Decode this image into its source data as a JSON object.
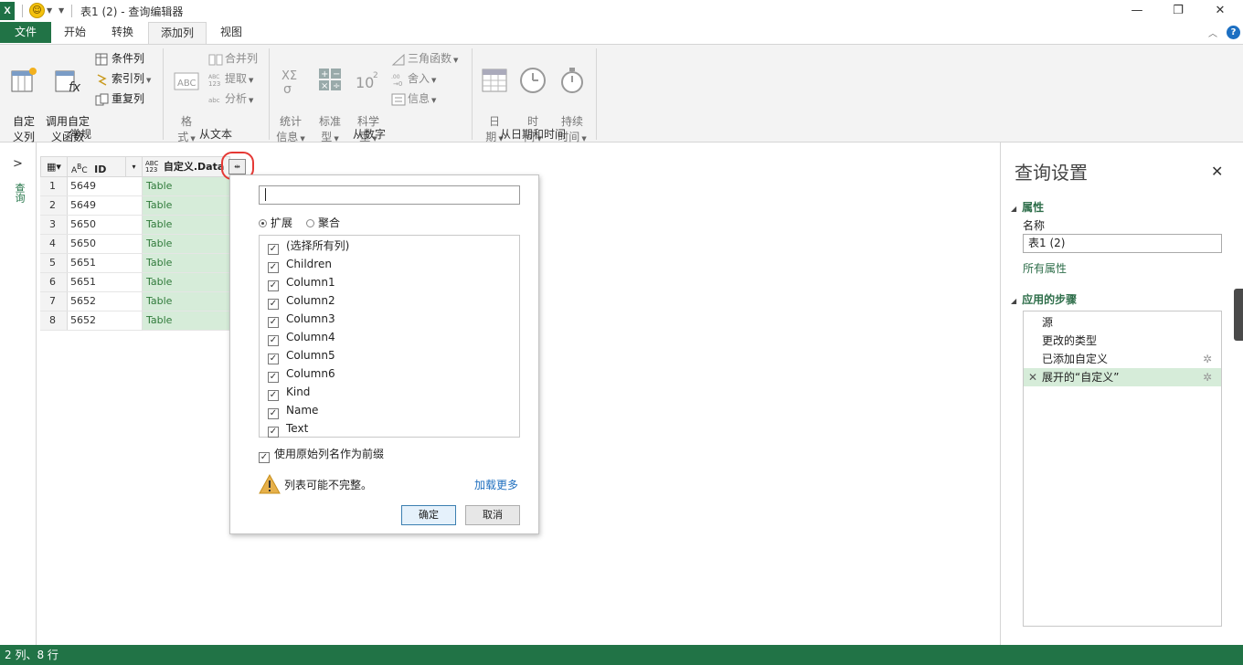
{
  "window": {
    "title": "表1 (2) - 查询编辑器",
    "app_logo": "X"
  },
  "qat": {
    "smiley": "☺"
  },
  "menu": {
    "tabs": [
      "文件",
      "开始",
      "转换",
      "添加列",
      "视图"
    ],
    "active_tab": "添加列"
  },
  "ribbon": {
    "groups": [
      "常规",
      "从文本",
      "从数字",
      "从日期和时间"
    ],
    "custom_column": "自定\n义列",
    "invoke_function": "调用自定\n义函数",
    "conditional_column": "条件列",
    "index_column": "索引列",
    "duplicate_column": "重复列",
    "format": "格\n式",
    "merge_columns": "合并列",
    "extract": "提取",
    "parse": "分析",
    "statistics": "统计\n信息",
    "standard": "标准\n型",
    "scientific": "科学\n型",
    "trigonometry": "三角函数",
    "rounding": "舍入",
    "information": "信息",
    "date": "日\n期",
    "time": "时\n间",
    "duration": "持续\n时间"
  },
  "left_panel": {
    "label": "查询"
  },
  "grid": {
    "col_id": "ID",
    "col_data": "自定义.Data",
    "abc_label": "ABC",
    "num_label": "123",
    "rows": [
      {
        "n": "1",
        "id": "5649",
        "data": "Table"
      },
      {
        "n": "2",
        "id": "5649",
        "data": "Table"
      },
      {
        "n": "3",
        "id": "5650",
        "data": "Table"
      },
      {
        "n": "4",
        "id": "5650",
        "data": "Table"
      },
      {
        "n": "5",
        "id": "5651",
        "data": "Table"
      },
      {
        "n": "6",
        "id": "5651",
        "data": "Table"
      },
      {
        "n": "7",
        "id": "5652",
        "data": "Table"
      },
      {
        "n": "8",
        "id": "5652",
        "data": "Table"
      }
    ]
  },
  "expand_popup": {
    "search_value": "",
    "mode_expand": "扩展",
    "mode_aggregate": "聚合",
    "columns": [
      "(选择所有列)",
      "Children",
      "Column1",
      "Column2",
      "Column3",
      "Column4",
      "Column5",
      "Column6",
      "Kind",
      "Name",
      "Text"
    ],
    "use_prefix": "使用原始列名作为前缀",
    "warning": "列表可能不完整。",
    "load_more": "加载更多",
    "ok": "确定",
    "cancel": "取消"
  },
  "query_settings": {
    "title": "查询设置",
    "properties_header": "属性",
    "name_label": "名称",
    "name_value": "表1 (2)",
    "all_properties": "所有属性",
    "steps_header": "应用的步骤",
    "steps": [
      "源",
      "更改的类型",
      "已添加自定义",
      "展开的“自定义”"
    ]
  },
  "status": {
    "text": "2 列、8 行"
  },
  "colors": {
    "accent": "#217346",
    "selected": "#d6ecd9",
    "link": "#1f6fbf"
  }
}
